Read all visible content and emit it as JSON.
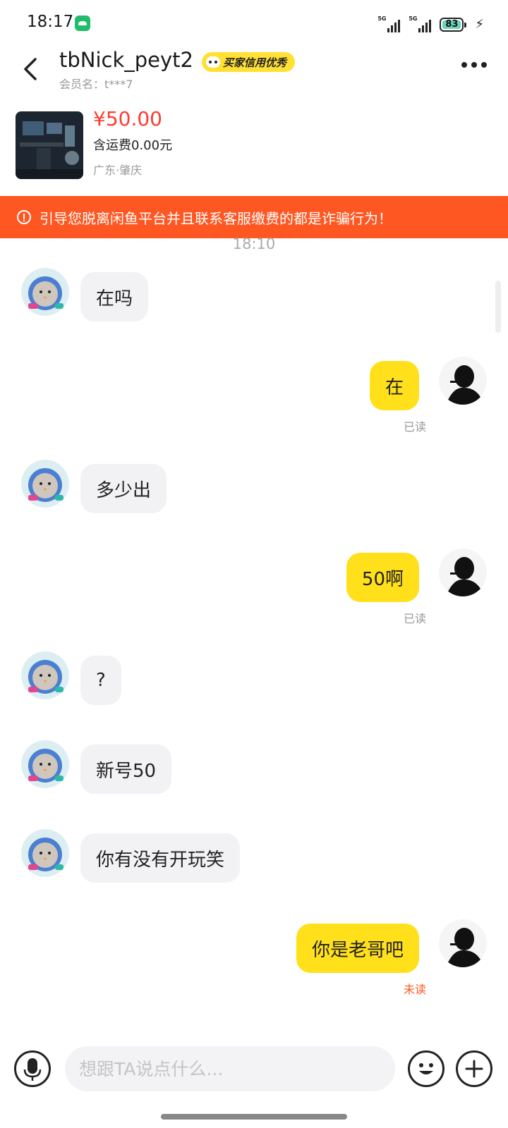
{
  "status_bar": {
    "time": "18:17",
    "network_1": "5G",
    "network_2": "5G",
    "battery": "83"
  },
  "header": {
    "title": "tbNick_peyt2",
    "credit_badge": "买家信用优秀",
    "member_name": "会员名：t***7"
  },
  "product": {
    "price": "¥50.00",
    "shipping": "含运费0.00元",
    "location": "广东·肇庆"
  },
  "warning": {
    "text": "引导您脱离闲鱼平台并且联系客服缴费的都是诈骗行为！"
  },
  "chat": {
    "timestamp": "18:10",
    "messages": [
      {
        "side": "left",
        "text": "在吗"
      },
      {
        "side": "right",
        "text": "在",
        "status": "已读"
      },
      {
        "side": "left",
        "text": "多少出"
      },
      {
        "side": "right",
        "text": "50啊",
        "status": "已读"
      },
      {
        "side": "left",
        "text": "?"
      },
      {
        "side": "left",
        "text": "新号50"
      },
      {
        "side": "left",
        "text": "你有没有开玩笑"
      },
      {
        "side": "right",
        "text": "你是老哥吧",
        "status": "未读"
      }
    ]
  },
  "input": {
    "placeholder": "想跟TA说点什么..."
  },
  "colors": {
    "accent_yellow": "#ffe01b",
    "warning_orange": "#ff5722",
    "price_red": "#ff3b30"
  }
}
